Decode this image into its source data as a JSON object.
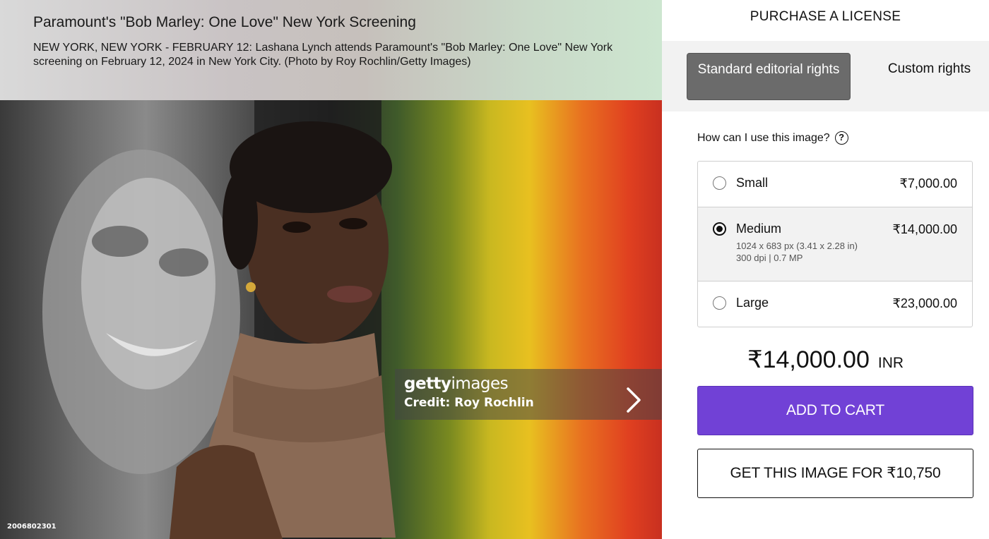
{
  "caption": {
    "title": "Paramount's \"Bob Marley: One Love\" New York Screening",
    "description": "NEW YORK, NEW YORK - FEBRUARY 12: Lashana Lynch attends Paramount's \"Bob Marley: One Love\" New York screening on February 12, 2024 in New York City. (Photo by Roy Rochlin/Getty Images)"
  },
  "photo": {
    "watermark_brand_bold": "getty",
    "watermark_brand_light": "images",
    "credit": "Credit: Roy Rochlin",
    "image_id": "2006802301",
    "next_icon": "chevron-right-icon"
  },
  "purchase": {
    "heading": "PURCHASE A LICENSE",
    "tabs": [
      {
        "label": "Standard editorial rights",
        "selected": true
      },
      {
        "label": "Custom rights",
        "selected": false
      }
    ],
    "usage_question": "How can I use this image?",
    "help_icon": "question-circle-icon",
    "sizes": [
      {
        "name": "Small",
        "price": "₹7,000.00",
        "selected": false
      },
      {
        "name": "Medium",
        "price": "₹14,000.00",
        "selected": true,
        "dimensions": "1024 x 683 px (3.41 x 2.28 in)",
        "resolution": "300 dpi | 0.7 MP"
      },
      {
        "name": "Large",
        "price": "₹23,000.00",
        "selected": false
      }
    ],
    "total_amount": "₹14,000.00",
    "currency": "INR",
    "add_to_cart_label": "ADD TO CART",
    "get_image_label": "GET THIS IMAGE FOR ₹10,750"
  },
  "colors": {
    "accent": "#7141d6",
    "selected_tab": "#6b6b6b"
  }
}
